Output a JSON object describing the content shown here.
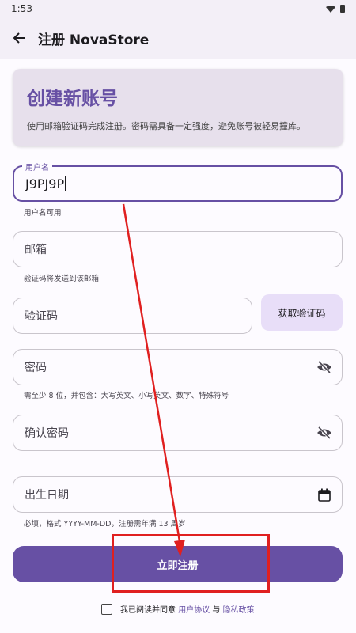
{
  "status_bar": {
    "time": "1:53"
  },
  "app_bar": {
    "title": "注册 NovaStore"
  },
  "hero": {
    "title": "创建新账号",
    "subtitle": "使用邮箱验证码完成注册。密码需具备一定强度，避免账号被轻易撞库。"
  },
  "username": {
    "label": "用户名",
    "value": "J9PJ9P",
    "helper": "用户名可用"
  },
  "email": {
    "placeholder": "邮箱",
    "helper": "验证码将发送到该邮箱"
  },
  "code": {
    "placeholder": "验证码",
    "button": "获取验证码"
  },
  "password": {
    "placeholder": "密码",
    "helper": "需至少 8 位，并包含：大写英文、小写英文、数字、特殊符号"
  },
  "confirm_password": {
    "placeholder": "确认密码"
  },
  "birthdate": {
    "placeholder": "出生日期",
    "helper": "必填，格式 YYYY-MM-DD，注册需年满 13 周岁"
  },
  "submit": {
    "label": "立即注册"
  },
  "terms": {
    "prefix": "我已阅读并同意",
    "user_agreement": "用户协议",
    "and": "与",
    "privacy_policy": "隐私政策"
  },
  "colors": {
    "accent": "#6750a4",
    "annotation": "#e02020"
  },
  "icons": [
    "back-arrow-icon",
    "wifi-icon",
    "battery-icon",
    "visibility-off-icon",
    "calendar-icon"
  ]
}
